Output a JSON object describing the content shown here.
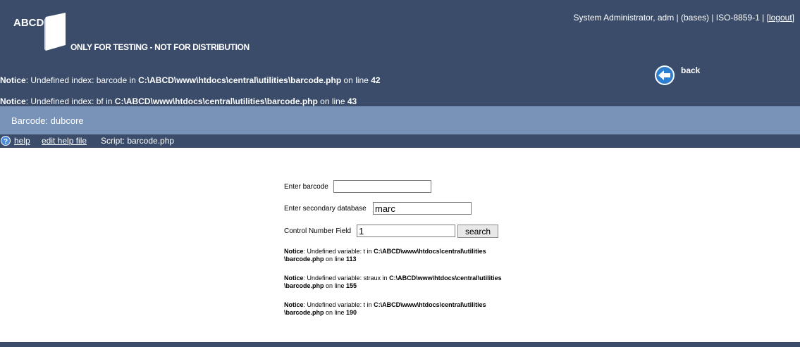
{
  "header": {
    "logo_text": "ABCD",
    "tagline": "ONLY FOR TESTING - NOT FOR DISTRIBUTION",
    "user_text": "System Administrator, adm | (bases) | ISO-8859-1 |",
    "logout_label": "[logout]",
    "back_label": "back",
    "notices": [
      {
        "prefix": "Notice",
        "message": ": Undefined index: barcode in ",
        "path": "C:\\ABCD\\www\\htdocs\\central\\utilities\\barcode.php",
        "line_text": " on line ",
        "line": "42"
      },
      {
        "prefix": "Notice",
        "message": ": Undefined index: bf in ",
        "path": "C:\\ABCD\\www\\htdocs\\central\\utilities\\barcode.php",
        "line_text": " on line ",
        "line": "43"
      }
    ]
  },
  "titlebar": {
    "title": "Barcode: dubcore"
  },
  "helpbar": {
    "help_label": "help",
    "edit_help_label": "edit help file",
    "script_label": "Script: barcode.php"
  },
  "form": {
    "barcode_label": "Enter barcode",
    "barcode_value": "",
    "secondary_label": "Enter secondary database",
    "secondary_value": "marc",
    "control_label": "Control Number Field",
    "control_value": "1",
    "search_label": "search"
  },
  "body_notices": [
    {
      "prefix": "Notice",
      "message": ": Undefined variable: t in ",
      "path1": "C:\\ABCD\\www\\htdocs\\central\\utilities",
      "path2": "\\barcode.php",
      "line_text": " on line ",
      "line": "113"
    },
    {
      "prefix": "Notice",
      "message": ": Undefined variable: straux in ",
      "path1": "C:\\ABCD\\www\\htdocs\\central\\utilities",
      "path2": "\\barcode.php",
      "line_text": " on line ",
      "line": "155"
    },
    {
      "prefix": "Notice",
      "message": ": Undefined variable: t in ",
      "path1": "C:\\ABCD\\www\\htdocs\\central\\utilities",
      "path2": "\\barcode.php",
      "line_text": " on line ",
      "line": "190"
    }
  ],
  "colors": {
    "header_bg": "#3a4c69",
    "titlebar_bg": "#7893b7",
    "back_icon": "#2f7fd0"
  },
  "icons": {
    "back": "back-arrow-icon",
    "help": "question-mark-icon",
    "logo": "open-book-icon"
  }
}
